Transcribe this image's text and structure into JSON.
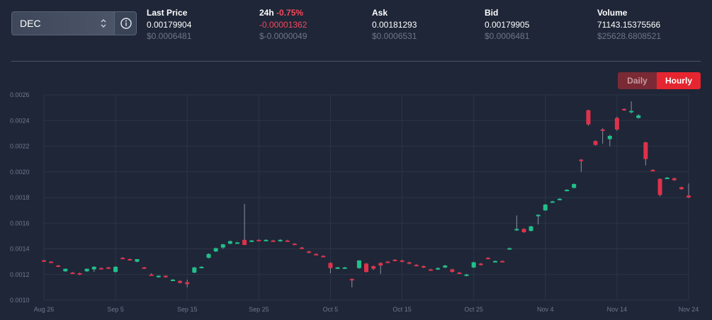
{
  "selector": {
    "value": "DEC",
    "chevron_icon": "chevron-updown-icon",
    "info_icon": "info-icon"
  },
  "stats": [
    {
      "label": "Last Price",
      "change": "",
      "value": "0.00179904",
      "secondary": "$0.0006481",
      "value_color": "white"
    },
    {
      "label": "24h",
      "change": "-0.75%",
      "value": "-0.00001362",
      "secondary": "$-0.0000049",
      "value_color": "red"
    },
    {
      "label": "Ask",
      "change": "",
      "value": "0.00181293",
      "secondary": "$0.0006531",
      "value_color": "white"
    },
    {
      "label": "Bid",
      "change": "",
      "value": "0.00179905",
      "secondary": "$0.0006481",
      "value_color": "white"
    },
    {
      "label": "Volume",
      "change": "",
      "value": "71143.15375566",
      "secondary": "$25628.6808521",
      "value_color": "white"
    }
  ],
  "toggle": {
    "daily": "Daily",
    "hourly": "Hourly",
    "active": "Hourly"
  },
  "colors": {
    "up": "#1fc18a",
    "down": "#e0314b",
    "background": "#1e2637",
    "grid": "#2c3546",
    "accent": "#e5252f"
  },
  "chart_data": {
    "type": "candlestick",
    "y_ticks": [
      "0.0010",
      "0.0012",
      "0.0014",
      "0.0016",
      "0.0018",
      "0.0020",
      "0.0022",
      "0.0024",
      "0.0026"
    ],
    "ylim": [
      0.001,
      0.0026
    ],
    "x_ticks": [
      {
        "label": "Aug 26",
        "day": 0
      },
      {
        "label": "Sep 5",
        "day": 10
      },
      {
        "label": "Sep 15",
        "day": 20
      },
      {
        "label": "Sep 25",
        "day": 30
      },
      {
        "label": "Oct 5",
        "day": 40
      },
      {
        "label": "Oct 15",
        "day": 50
      },
      {
        "label": "Oct 25",
        "day": 60
      },
      {
        "label": "Nov 4",
        "day": 70
      },
      {
        "label": "Nov 14",
        "day": 80
      },
      {
        "label": "Nov 24",
        "day": 90
      }
    ],
    "grid": true,
    "candles": [
      {
        "day": 0,
        "o": 0.00131,
        "h": 0.001315,
        "l": 0.0013,
        "c": 0.001305
      },
      {
        "day": 1,
        "o": 0.0013,
        "h": 0.001305,
        "l": 0.00129,
        "c": 0.001295
      },
      {
        "day": 2,
        "o": 0.00127,
        "h": 0.001275,
        "l": 0.00126,
        "c": 0.001265
      },
      {
        "day": 3,
        "o": 0.001225,
        "h": 0.001245,
        "l": 0.00122,
        "c": 0.001245
      },
      {
        "day": 4,
        "o": 0.001215,
        "h": 0.00122,
        "l": 0.001205,
        "c": 0.00121
      },
      {
        "day": 5,
        "o": 0.00121,
        "h": 0.001215,
        "l": 0.001195,
        "c": 0.0012
      },
      {
        "day": 6,
        "o": 0.001225,
        "h": 0.001245,
        "l": 0.00122,
        "c": 0.001245
      },
      {
        "day": 7,
        "o": 0.00124,
        "h": 0.001265,
        "l": 0.00122,
        "c": 0.00126
      },
      {
        "day": 8,
        "o": 0.00125,
        "h": 0.001255,
        "l": 0.00124,
        "c": 0.001245
      },
      {
        "day": 9,
        "o": 0.001255,
        "h": 0.00126,
        "l": 0.001245,
        "c": 0.00125
      },
      {
        "day": 10,
        "o": 0.00122,
        "h": 0.001265,
        "l": 0.001215,
        "c": 0.00126
      },
      {
        "day": 11,
        "o": 0.00133,
        "h": 0.001335,
        "l": 0.00132,
        "c": 0.001325
      },
      {
        "day": 12,
        "o": 0.00132,
        "h": 0.001325,
        "l": 0.00131,
        "c": 0.001315
      },
      {
        "day": 13,
        "o": 0.0013,
        "h": 0.00132,
        "l": 0.001295,
        "c": 0.00132
      },
      {
        "day": 14,
        "o": 0.001255,
        "h": 0.00126,
        "l": 0.001245,
        "c": 0.00125
      },
      {
        "day": 15,
        "o": 0.0012,
        "h": 0.00121,
        "l": 0.00119,
        "c": 0.001195
      },
      {
        "day": 16,
        "o": 0.00118,
        "h": 0.001195,
        "l": 0.001175,
        "c": 0.00119
      },
      {
        "day": 17,
        "o": 0.00119,
        "h": 0.001195,
        "l": 0.001175,
        "c": 0.00118
      },
      {
        "day": 18,
        "o": 0.001155,
        "h": 0.001165,
        "l": 0.00115,
        "c": 0.00116
      },
      {
        "day": 19,
        "o": 0.00115,
        "h": 0.001155,
        "l": 0.00113,
        "c": 0.001135
      },
      {
        "day": 20,
        "o": 0.00114,
        "h": 0.00116,
        "l": 0.0011,
        "c": 0.001125
      },
      {
        "day": 21,
        "o": 0.001215,
        "h": 0.00126,
        "l": 0.00121,
        "c": 0.001255
      },
      {
        "day": 22,
        "o": 0.001255,
        "h": 0.001265,
        "l": 0.00125,
        "c": 0.00126
      },
      {
        "day": 23,
        "o": 0.00133,
        "h": 0.001365,
        "l": 0.001325,
        "c": 0.00136
      },
      {
        "day": 24,
        "o": 0.00138,
        "h": 0.00141,
        "l": 0.001375,
        "c": 0.001405
      },
      {
        "day": 25,
        "o": 0.00141,
        "h": 0.00144,
        "l": 0.0014,
        "c": 0.001435
      },
      {
        "day": 26,
        "o": 0.00144,
        "h": 0.001465,
        "l": 0.001435,
        "c": 0.00146
      },
      {
        "day": 27,
        "o": 0.001445,
        "h": 0.001455,
        "l": 0.00144,
        "c": 0.00145
      },
      {
        "day": 28,
        "o": 0.00147,
        "h": 0.00175,
        "l": 0.00144,
        "c": 0.00143
      },
      {
        "day": 29,
        "o": 0.001465,
        "h": 0.00147,
        "l": 0.00146,
        "c": 0.001465
      },
      {
        "day": 30,
        "o": 0.00147,
        "h": 0.001475,
        "l": 0.00146,
        "c": 0.001465
      },
      {
        "day": 31,
        "o": 0.00147,
        "h": 0.001475,
        "l": 0.001465,
        "c": 0.00147
      },
      {
        "day": 32,
        "o": 0.001465,
        "h": 0.00147,
        "l": 0.001455,
        "c": 0.00146
      },
      {
        "day": 33,
        "o": 0.00146,
        "h": 0.001475,
        "l": 0.001455,
        "c": 0.00147
      },
      {
        "day": 34,
        "o": 0.001465,
        "h": 0.00147,
        "l": 0.001455,
        "c": 0.00146
      },
      {
        "day": 35,
        "o": 0.00144,
        "h": 0.001445,
        "l": 0.00143,
        "c": 0.001435
      },
      {
        "day": 36,
        "o": 0.00141,
        "h": 0.001415,
        "l": 0.0014,
        "c": 0.001405
      },
      {
        "day": 37,
        "o": 0.00138,
        "h": 0.001385,
        "l": 0.001365,
        "c": 0.00137
      },
      {
        "day": 38,
        "o": 0.00136,
        "h": 0.001365,
        "l": 0.00135,
        "c": 0.001355
      },
      {
        "day": 39,
        "o": 0.001345,
        "h": 0.00135,
        "l": 0.001335,
        "c": 0.00134
      },
      {
        "day": 40,
        "o": 0.00129,
        "h": 0.001295,
        "l": 0.00121,
        "c": 0.00125
      },
      {
        "day": 41,
        "o": 0.001255,
        "h": 0.00126,
        "l": 0.00125,
        "c": 0.001255
      },
      {
        "day": 42,
        "o": 0.001255,
        "h": 0.00126,
        "l": 0.00125,
        "c": 0.001255
      },
      {
        "day": 43,
        "o": 0.001165,
        "h": 0.00117,
        "l": 0.0011,
        "c": 0.00116
      },
      {
        "day": 44,
        "o": 0.00125,
        "h": 0.00131,
        "l": 0.001245,
        "c": 0.00131
      },
      {
        "day": 45,
        "o": 0.001285,
        "h": 0.00129,
        "l": 0.001215,
        "c": 0.00122
      },
      {
        "day": 46,
        "o": 0.001265,
        "h": 0.00127,
        "l": 0.001235,
        "c": 0.001245
      },
      {
        "day": 47,
        "o": 0.00129,
        "h": 0.001295,
        "l": 0.001205,
        "c": 0.00127
      },
      {
        "day": 48,
        "o": 0.0013,
        "h": 0.001305,
        "l": 0.00129,
        "c": 0.001295
      },
      {
        "day": 49,
        "o": 0.001315,
        "h": 0.00132,
        "l": 0.001305,
        "c": 0.00131
      },
      {
        "day": 50,
        "o": 0.00131,
        "h": 0.001315,
        "l": 0.001295,
        "c": 0.0013
      },
      {
        "day": 51,
        "o": 0.001295,
        "h": 0.0013,
        "l": 0.00128,
        "c": 0.001285
      },
      {
        "day": 52,
        "o": 0.001275,
        "h": 0.00128,
        "l": 0.001265,
        "c": 0.00127
      },
      {
        "day": 53,
        "o": 0.001265,
        "h": 0.00127,
        "l": 0.00125,
        "c": 0.001255
      },
      {
        "day": 54,
        "o": 0.00124,
        "h": 0.001245,
        "l": 0.00123,
        "c": 0.001235
      },
      {
        "day": 55,
        "o": 0.00124,
        "h": 0.001255,
        "l": 0.001235,
        "c": 0.00125
      },
      {
        "day": 56,
        "o": 0.001255,
        "h": 0.001275,
        "l": 0.00125,
        "c": 0.00127
      },
      {
        "day": 57,
        "o": 0.00124,
        "h": 0.001245,
        "l": 0.001215,
        "c": 0.00122
      },
      {
        "day": 58,
        "o": 0.001215,
        "h": 0.00122,
        "l": 0.001205,
        "c": 0.00121
      },
      {
        "day": 59,
        "o": 0.00119,
        "h": 0.001205,
        "l": 0.001185,
        "c": 0.0012
      },
      {
        "day": 60,
        "o": 0.001255,
        "h": 0.0013,
        "l": 0.00125,
        "c": 0.001295
      },
      {
        "day": 61,
        "o": 0.001285,
        "h": 0.00129,
        "l": 0.00127,
        "c": 0.00128
      },
      {
        "day": 62,
        "o": 0.00133,
        "h": 0.001335,
        "l": 0.00132,
        "c": 0.001325
      },
      {
        "day": 63,
        "o": 0.001305,
        "h": 0.00131,
        "l": 0.0013,
        "c": 0.001305
      },
      {
        "day": 64,
        "o": 0.001305,
        "h": 0.00131,
        "l": 0.001295,
        "c": 0.0013
      },
      {
        "day": 65,
        "o": 0.0014,
        "h": 0.00141,
        "l": 0.001395,
        "c": 0.001405
      },
      {
        "day": 66,
        "o": 0.00155,
        "h": 0.00166,
        "l": 0.00154,
        "c": 0.001555
      },
      {
        "day": 67,
        "o": 0.001555,
        "h": 0.00156,
        "l": 0.001525,
        "c": 0.00153
      },
      {
        "day": 68,
        "o": 0.00154,
        "h": 0.00158,
        "l": 0.001535,
        "c": 0.001575
      },
      {
        "day": 69,
        "o": 0.001655,
        "h": 0.00167,
        "l": 0.00159,
        "c": 0.001665
      },
      {
        "day": 70,
        "o": 0.0017,
        "h": 0.00175,
        "l": 0.001695,
        "c": 0.001745
      },
      {
        "day": 71,
        "o": 0.001765,
        "h": 0.001775,
        "l": 0.00176,
        "c": 0.00177
      },
      {
        "day": 72,
        "o": 0.001785,
        "h": 0.001795,
        "l": 0.00178,
        "c": 0.00179
      },
      {
        "day": 73,
        "o": 0.001855,
        "h": 0.001865,
        "l": 0.00185,
        "c": 0.00186
      },
      {
        "day": 74,
        "o": 0.001875,
        "h": 0.00191,
        "l": 0.00187,
        "c": 0.001905
      },
      {
        "day": 75,
        "o": 0.002095,
        "h": 0.0021,
        "l": 0.002,
        "c": 0.00209
      },
      {
        "day": 76,
        "o": 0.00248,
        "h": 0.002485,
        "l": 0.00236,
        "c": 0.00237
      },
      {
        "day": 77,
        "o": 0.00224,
        "h": 0.002245,
        "l": 0.002205,
        "c": 0.00221
      },
      {
        "day": 78,
        "o": 0.00233,
        "h": 0.00234,
        "l": 0.00222,
        "c": 0.002325
      },
      {
        "day": 79,
        "o": 0.002255,
        "h": 0.00229,
        "l": 0.0022,
        "c": 0.00228
      },
      {
        "day": 80,
        "o": 0.00242,
        "h": 0.00243,
        "l": 0.00232,
        "c": 0.00233
      },
      {
        "day": 81,
        "o": 0.00249,
        "h": 0.002495,
        "l": 0.002475,
        "c": 0.00248
      },
      {
        "day": 82,
        "o": 0.00247,
        "h": 0.00255,
        "l": 0.002455,
        "c": 0.002475
      },
      {
        "day": 83,
        "o": 0.00242,
        "h": 0.00245,
        "l": 0.002415,
        "c": 0.00244
      },
      {
        "day": 84,
        "o": 0.00223,
        "h": 0.002235,
        "l": 0.00205,
        "c": 0.0021
      },
      {
        "day": 85,
        "o": 0.002015,
        "h": 0.00202,
        "l": 0.002005,
        "c": 0.00201
      },
      {
        "day": 86,
        "o": 0.001945,
        "h": 0.00195,
        "l": 0.00181,
        "c": 0.00182
      },
      {
        "day": 87,
        "o": 0.00195,
        "h": 0.00196,
        "l": 0.001945,
        "c": 0.001955
      },
      {
        "day": 88,
        "o": 0.00195,
        "h": 0.001955,
        "l": 0.00193,
        "c": 0.001935
      },
      {
        "day": 89,
        "o": 0.00188,
        "h": 0.001885,
        "l": 0.00186,
        "c": 0.001865
      },
      {
        "day": 90,
        "o": 0.001815,
        "h": 0.00191,
        "l": 0.001795,
        "c": 0.0018
      }
    ]
  }
}
